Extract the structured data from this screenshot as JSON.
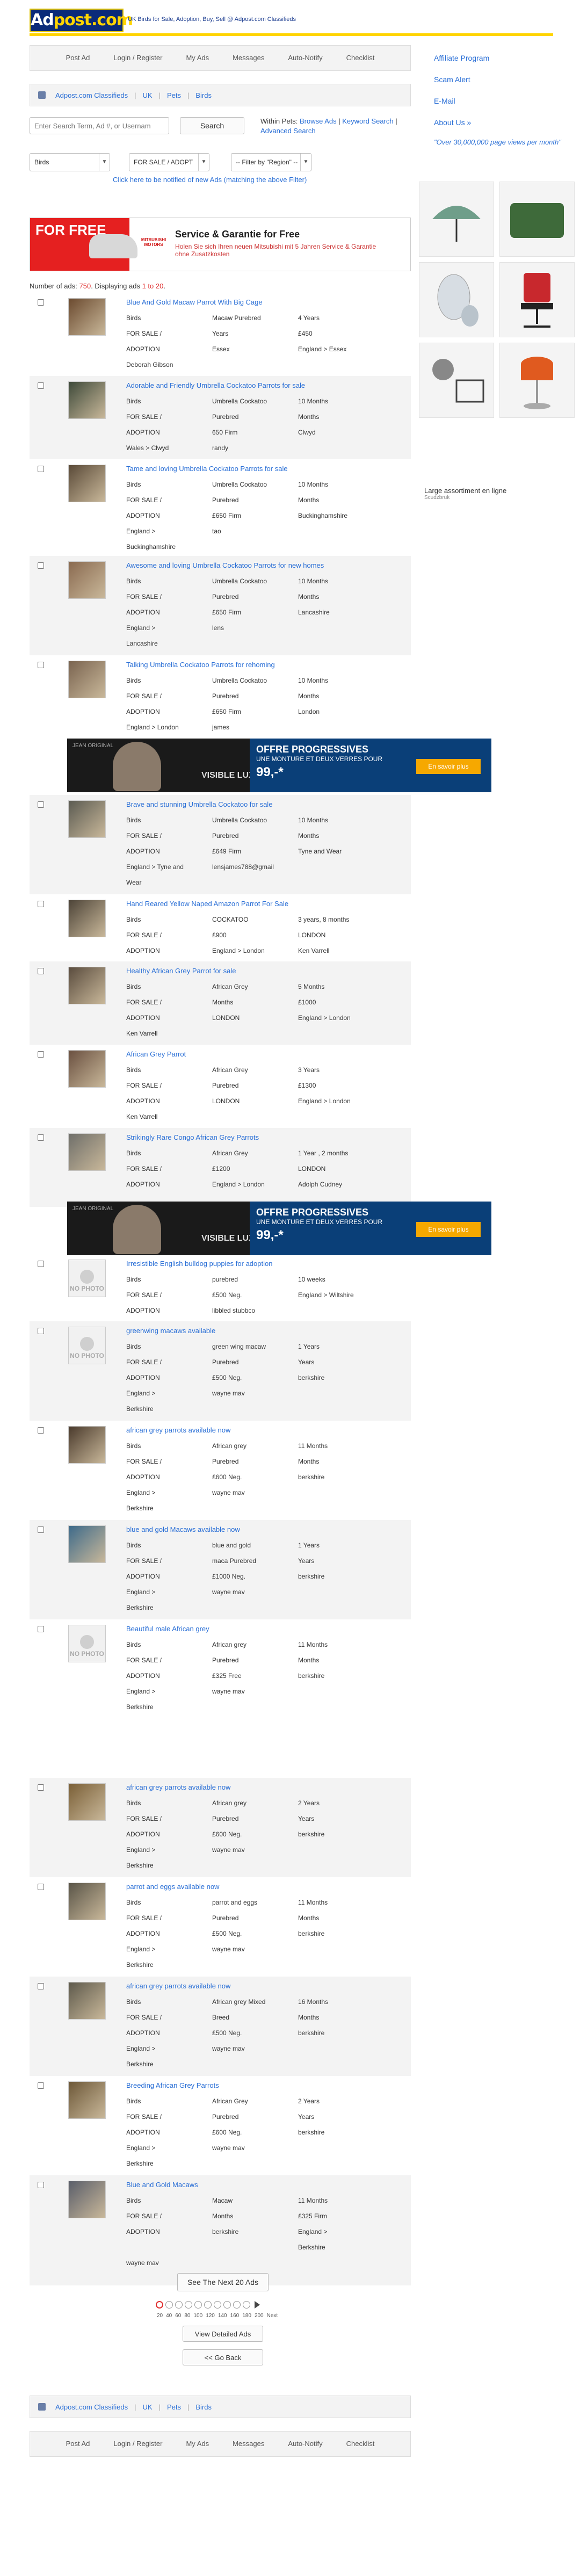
{
  "header": {
    "logo": "Adpost.com",
    "tagline": "UK Birds for Sale, Adoption, Buy, Sell @ Adpost.com Classifieds"
  },
  "top_nav": [
    "Post Ad",
    "Login / Register",
    "My Ads",
    "Messages",
    "Auto-Notify",
    "Checklist"
  ],
  "breadcrumb": [
    "Adpost.com Classifieds",
    "UK",
    "Pets",
    "Birds"
  ],
  "search": {
    "placeholder": "Enter Search Term, Ad #, or Usernam",
    "button": "Search",
    "within_prefix": "Within Pets: ",
    "browse_ads": "Browse Ads",
    "keyword_search": "Keyword Search",
    "advanced_search": "Advanced Search"
  },
  "filters": {
    "category": "Birds",
    "type": "FOR SALE / ADOPT",
    "region": "-- Filter by \"Region\" --",
    "notify_text": "Click here to be notified of new Ads (matching the above Filter)"
  },
  "right_column": {
    "links": [
      "Affiliate Program",
      "Scam Alert",
      "E-Mail",
      "About Us »"
    ],
    "stat": "\"Over 30,000,000 page views per month\" ",
    "ad_caption": "Large assortiment en ligne",
    "ad_source": "Scudzbruk"
  },
  "banner_top": {
    "label": "FOR FREE",
    "brand": "MITSUBISHI MOTORS",
    "title": "Service & Garantie for Free",
    "subtitle": "Holen Sie sich Ihren neuen Mitsubishi mit 5 Jahren Service & Garantie ohne Zusatzkosten"
  },
  "count": {
    "prefix": "Number of ads: ",
    "total": "750",
    "middle": ". Displaying ads ",
    "range": "1 to 20",
    "suffix": "."
  },
  "listings": [
    {
      "title": "Blue And Gold Macaw Parrot With Big Cage",
      "cells": [
        [
          "Birds",
          "Macaw Purebred",
          "4 Years"
        ],
        [
          "FOR SALE /",
          "Years",
          "£450"
        ],
        [
          "ADOPTION",
          "Essex",
          "England > Essex"
        ],
        [
          "Deborah Gibson",
          "",
          ""
        ]
      ]
    },
    {
      "title": "Adorable and Friendly Umbrella Cockatoo Parrots for sale",
      "cells": [
        [
          "Birds",
          "Umbrella Cockatoo",
          "10 Months"
        ],
        [
          "FOR SALE /",
          "Purebred",
          "Months"
        ],
        [
          "ADOPTION",
          "650 Firm",
          "Clwyd"
        ],
        [
          "Wales > Clwyd",
          "randy",
          ""
        ]
      ]
    },
    {
      "title": "Tame and loving Umbrella Cockatoo Parrots for sale",
      "cells": [
        [
          "Birds",
          "Umbrella Cockatoo",
          "10 Months"
        ],
        [
          "FOR SALE /",
          "Purebred",
          "Months"
        ],
        [
          "ADOPTION",
          "£650 Firm",
          "Buckinghamshire"
        ],
        [
          "England >",
          "tao",
          ""
        ],
        [
          "Buckinghamshire",
          "",
          ""
        ]
      ]
    },
    {
      "title": "Awesome and loving Umbrella Cockatoo Parrots for new homes",
      "cells": [
        [
          "Birds",
          "Umbrella Cockatoo",
          "10 Months"
        ],
        [
          "FOR SALE /",
          "Purebred",
          "Months"
        ],
        [
          "ADOPTION",
          "£650 Firm",
          "Lancashire"
        ],
        [
          "England >",
          "lens",
          ""
        ],
        [
          "Lancashire",
          "",
          ""
        ]
      ]
    },
    {
      "title": "Talking Umbrella Cockatoo Parrots for rehoming",
      "cells": [
        [
          "Birds",
          "Umbrella Cockatoo",
          "10 Months"
        ],
        [
          "FOR SALE /",
          "Purebred",
          "Months"
        ],
        [
          "ADOPTION",
          "£650 Firm",
          "London"
        ],
        [
          "England > London",
          "james",
          ""
        ]
      ]
    },
    {
      "title": "Brave and stunning Umbrella Cockatoo for sale",
      "cells": [
        [
          "Birds",
          "Umbrella Cockatoo",
          "10 Months"
        ],
        [
          "FOR SALE /",
          "Purebred",
          "Months"
        ],
        [
          "ADOPTION",
          "£649 Firm",
          "Tyne and Wear"
        ],
        [
          "England > Tyne and",
          "lensjames788@gmail",
          ""
        ],
        [
          "Wear",
          "",
          ""
        ]
      ]
    },
    {
      "title": "Hand Reared Yellow Naped Amazon Parrot For Sale",
      "cells": [
        [
          "Birds",
          "COCKATOO",
          "3 years, 8 months"
        ],
        [
          "FOR SALE /",
          "£900",
          "LONDON"
        ],
        [
          "ADOPTION",
          "England > London",
          "Ken Varrell"
        ]
      ]
    },
    {
      "title": "Healthy African Grey Parrot for sale",
      "cells": [
        [
          "Birds",
          "African Grey",
          "5 Months"
        ],
        [
          "FOR SALE /",
          "Months",
          "£1000"
        ],
        [
          "ADOPTION",
          "LONDON",
          "England > London"
        ],
        [
          "Ken Varrell",
          "",
          ""
        ]
      ]
    },
    {
      "title": "African Grey Parrot",
      "cells": [
        [
          "Birds",
          "African Grey",
          "3 Years"
        ],
        [
          "FOR SALE /",
          "Purebred",
          "£1300"
        ],
        [
          "ADOPTION",
          "LONDON",
          "England > London"
        ],
        [
          "Ken Varrell",
          "",
          ""
        ]
      ]
    },
    {
      "title": "Strikingly Rare Congo African Grey Parrots",
      "cells": [
        [
          "Birds",
          "African Grey",
          "1 Year , 2 months"
        ],
        [
          "FOR SALE /",
          "£1200",
          "LONDON"
        ],
        [
          "ADOPTION",
          "England > London",
          "Adolph Cudney"
        ]
      ]
    },
    {
      "title": "Irresistible English bulldog puppies for adoption",
      "nophoto": "NO PHOTO",
      "cells": [
        [
          "Birds",
          "purebred",
          "10 weeks"
        ],
        [
          "FOR SALE /",
          "£500 Neg.",
          "England > Wiltshire"
        ],
        [
          "ADOPTION",
          "libbled stubbco",
          ""
        ]
      ]
    },
    {
      "title": "greenwing macaws available",
      "nophoto": "NO PHOTO",
      "cells": [
        [
          "Birds",
          "green wing macaw",
          "1 Years"
        ],
        [
          "FOR SALE /",
          "Purebred",
          "Years"
        ],
        [
          "ADOPTION",
          "£500 Neg.",
          "berkshire"
        ],
        [
          "England >",
          "wayne mav",
          ""
        ],
        [
          "Berkshire",
          "",
          ""
        ]
      ]
    },
    {
      "title": "african grey parrots available now",
      "cells": [
        [
          "Birds",
          "African grey",
          "11 Months"
        ],
        [
          "FOR SALE /",
          "Purebred",
          "Months"
        ],
        [
          "ADOPTION",
          "£600 Neg.",
          "berkshire"
        ],
        [
          "England >",
          "wayne mav",
          ""
        ],
        [
          "Berkshire",
          "",
          ""
        ]
      ]
    },
    {
      "title": "blue and gold Macaws available now",
      "cells": [
        [
          "Birds",
          "blue and gold",
          "1 Years"
        ],
        [
          "FOR SALE /",
          "maca   Purebred",
          "Years"
        ],
        [
          "ADOPTION",
          "£1000 Neg.",
          "berkshire"
        ],
        [
          "England >",
          "wayne mav",
          ""
        ],
        [
          "Berkshire",
          "",
          ""
        ]
      ]
    },
    {
      "title": "Beautiful male African grey",
      "nophoto": "NO PHOTO",
      "cells": [
        [
          "Birds",
          "African grey",
          "11 Months"
        ],
        [
          "FOR SALE /",
          "Purebred",
          "Months"
        ],
        [
          "ADOPTION",
          "£325 Free",
          "berkshire"
        ],
        [
          "England >",
          "wayne mav",
          ""
        ],
        [
          "Berkshire",
          "",
          ""
        ]
      ]
    },
    {
      "title": "african grey parrots available now",
      "cells": [
        [
          "Birds",
          "African grey",
          "2 Years"
        ],
        [
          "FOR SALE /",
          "Purebred",
          "Years"
        ],
        [
          "ADOPTION",
          "£600 Neg.",
          "berkshire"
        ],
        [
          "England >",
          "wayne mav",
          ""
        ],
        [
          "Berkshire",
          "",
          ""
        ]
      ]
    },
    {
      "title": "parrot and eggs available now",
      "cells": [
        [
          "Birds",
          "parrot and eggs",
          "11 Months"
        ],
        [
          "FOR SALE /",
          "Purebred",
          "Months"
        ],
        [
          "ADOPTION",
          "£500 Neg.",
          "berkshire"
        ],
        [
          "England >",
          "wayne mav",
          ""
        ],
        [
          "Berkshire",
          "",
          ""
        ]
      ]
    },
    {
      "title": "african grey parrots available now",
      "cells": [
        [
          "Birds",
          "African grey Mixed",
          "16 Months"
        ],
        [
          "FOR SALE /",
          "Breed",
          "Months"
        ],
        [
          "ADOPTION",
          "£500 Neg.",
          "berkshire"
        ],
        [
          "England >",
          "wayne mav",
          ""
        ],
        [
          "Berkshire",
          "",
          ""
        ]
      ]
    },
    {
      "title": "Breeding African Grey Parrots",
      "cells": [
        [
          "Birds",
          "African Grey",
          "2 Years"
        ],
        [
          "FOR SALE /",
          "Purebred",
          "Years"
        ],
        [
          "ADOPTION",
          "£600 Neg.",
          "berkshire"
        ],
        [
          "England >",
          "wayne mav",
          ""
        ],
        [
          "Berkshire",
          "",
          ""
        ]
      ]
    },
    {
      "title": "Blue and Gold Macaws",
      "cells": [
        [
          "Birds",
          "Macaw",
          "11 Months"
        ],
        [
          "FOR SALE /",
          "Months",
          "£325 Firm"
        ],
        [
          "ADOPTION",
          "berkshire",
          "England >"
        ],
        [
          "",
          "",
          "Berkshire"
        ],
        [
          "wayne mav",
          "",
          ""
        ]
      ]
    }
  ],
  "mid_banner": {
    "logo": "JEAN ORIGINAL",
    "brand": "VISIBLE LUX",
    "offer_title": "OFFRE PROGRESSIVES",
    "offer_sub": "UNE MONTURE ET DEUX VERRES POUR",
    "price": "99,-*",
    "cta": "En savoir plus"
  },
  "pagination": {
    "next_button": "See The Next 20 Ads",
    "numbers": [
      "20",
      "40",
      "60",
      "80",
      "100",
      "120",
      "140",
      "160",
      "180",
      "200",
      "Next"
    ],
    "view_detailed": "View Detailed Ads",
    "go_back": "<< Go Back"
  }
}
